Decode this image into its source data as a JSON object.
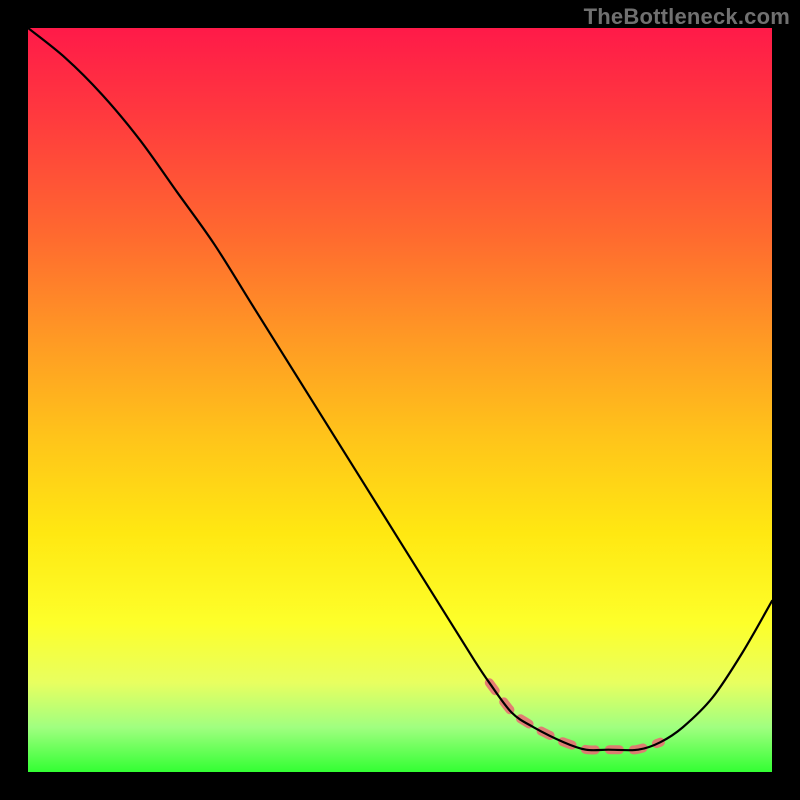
{
  "watermark": "TheBottleneck.com",
  "chart_data": {
    "type": "line",
    "title": "",
    "xlabel": "",
    "ylabel": "",
    "xlim": [
      0,
      100
    ],
    "ylim": [
      0,
      100
    ],
    "grid": false,
    "series": [
      {
        "name": "curve",
        "x": [
          0,
          5,
          10,
          15,
          20,
          25,
          30,
          35,
          40,
          45,
          50,
          55,
          60,
          62,
          65,
          68,
          72,
          75,
          78,
          82,
          85,
          88,
          92,
          96,
          100
        ],
        "values": [
          100,
          96,
          91,
          85,
          78,
          71,
          63,
          55,
          47,
          39,
          31,
          23,
          15,
          12,
          8,
          6,
          4,
          3,
          3,
          3,
          4,
          6,
          10,
          16,
          23
        ]
      }
    ],
    "annotations": [
      {
        "name": "optimal-range",
        "x_start": 62,
        "x_end": 85
      }
    ],
    "background": {
      "type": "vertical-gradient",
      "stops": [
        {
          "pos": 0.0,
          "color": "#ff1a49"
        },
        {
          "pos": 0.28,
          "color": "#ff6a2f"
        },
        {
          "pos": 0.55,
          "color": "#ffc41a"
        },
        {
          "pos": 0.8,
          "color": "#fdff2a"
        },
        {
          "pos": 1.0,
          "color": "#33ff33"
        }
      ]
    }
  }
}
